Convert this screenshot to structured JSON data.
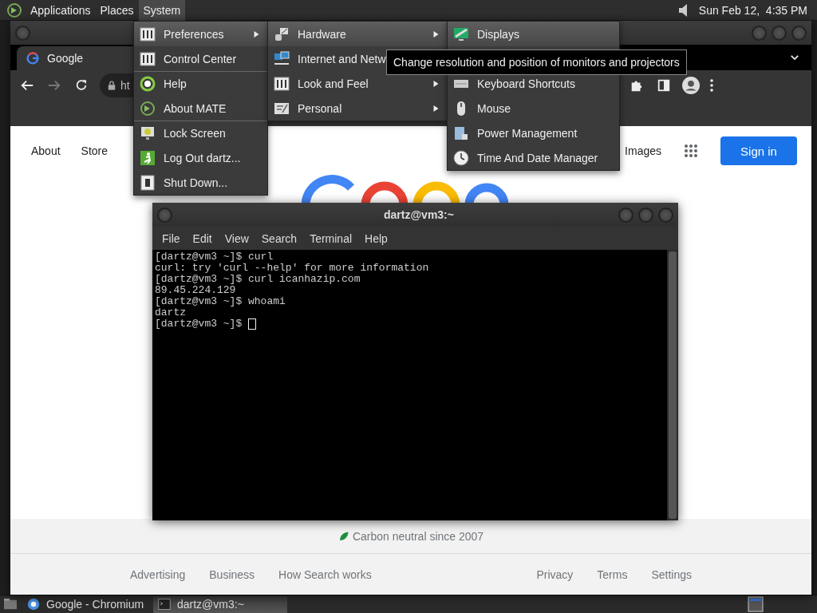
{
  "top_panel": {
    "menus": [
      {
        "label": "Applications",
        "selected": false
      },
      {
        "label": "Places",
        "selected": false
      },
      {
        "label": "System",
        "selected": true
      }
    ],
    "clock": "Sun Feb 12,  4:35 PM"
  },
  "browser": {
    "tab_title": "Google",
    "address": "ht",
    "forward_disabled": true,
    "nav_links": [
      "About",
      "Store"
    ],
    "images_link": "Images",
    "sign_in": "Sign in",
    "carbon": "Carbon neutral since 2007",
    "footer_left": [
      "Advertising",
      "Business",
      "How Search works"
    ],
    "footer_right": [
      "Privacy",
      "Terms",
      "Settings"
    ]
  },
  "terminal": {
    "title": "dartz@vm3:~",
    "menus": [
      "File",
      "Edit",
      "View",
      "Search",
      "Terminal",
      "Help"
    ],
    "lines": [
      "[dartz@vm3 ~]$ curl",
      "curl: try 'curl --help' for more information",
      "[dartz@vm3 ~]$ curl icanhazip.com",
      "89.45.224.129",
      "[dartz@vm3 ~]$ whoami",
      "dartz",
      "[dartz@vm3 ~]$ "
    ],
    "cursor": true
  },
  "system_menu": [
    {
      "label": "Preferences",
      "selected": true,
      "submenu": true,
      "separator": false
    },
    {
      "label": "Control Center",
      "selected": false,
      "submenu": false,
      "separator": false
    },
    {
      "label": "Help",
      "selected": false,
      "submenu": false,
      "separator": true
    },
    {
      "label": "About MATE",
      "selected": false,
      "submenu": false,
      "separator": false
    },
    {
      "label": "Lock Screen",
      "selected": false,
      "submenu": false,
      "separator": true
    },
    {
      "label": "Log Out dartz...",
      "selected": false,
      "submenu": false,
      "separator": false
    },
    {
      "label": "Shut Down...",
      "selected": false,
      "submenu": false,
      "separator": false
    }
  ],
  "preferences_menu": [
    {
      "label": "Hardware",
      "selected": true,
      "submenu": true
    },
    {
      "label": "Internet and Netw",
      "selected": false
    },
    {
      "label": "Look and Feel",
      "selected": false,
      "submenu": true
    },
    {
      "label": "Personal",
      "selected": false,
      "submenu": true
    }
  ],
  "hardware_menu": [
    {
      "label": "Displays",
      "selected": true
    },
    {
      "label": "Keyboard Shortcuts",
      "selected": false
    },
    {
      "label": "Mouse",
      "selected": false
    },
    {
      "label": "Power Management",
      "selected": false
    },
    {
      "label": "Time And Date Manager",
      "selected": false
    }
  ],
  "tooltip": "Change resolution and position of monitors and projectors",
  "taskbar": [
    {
      "label": "Google - Chromium",
      "kind": "browser",
      "selected": false
    },
    {
      "label": "dartz@vm3:~",
      "kind": "terminal",
      "selected": true
    }
  ]
}
